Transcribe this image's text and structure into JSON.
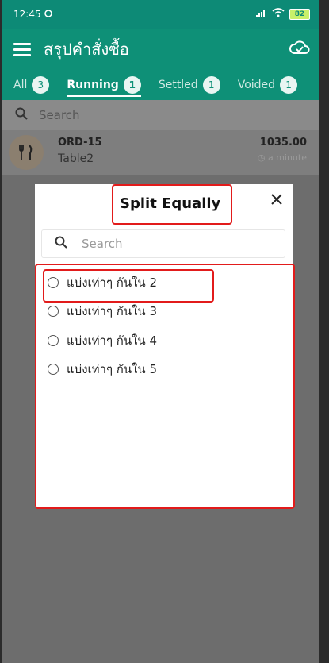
{
  "status": {
    "time": "12:45",
    "battery": "82"
  },
  "appbar": {
    "title": "สรุปคำสั่งซื้อ"
  },
  "tabs": [
    {
      "label": "All",
      "count": "3"
    },
    {
      "label": "Running",
      "count": "1"
    },
    {
      "label": "Settled",
      "count": "1"
    },
    {
      "label": "Voided",
      "count": "1"
    }
  ],
  "search": {
    "placeholder": "Search"
  },
  "order": {
    "id": "ORD-15",
    "table": "Table2",
    "amount": "1035.00",
    "time": "a minute"
  },
  "dialog": {
    "title": "Split Equally",
    "search_placeholder": "Search",
    "options": [
      "แบ่งเท่าๆ กันใน 2",
      "แบ่งเท่าๆ กันใน 3",
      "แบ่งเท่าๆ กันใน 4",
      "แบ่งเท่าๆ กันใน 5"
    ]
  },
  "colors": {
    "primary": "#0e9077",
    "highlight": "#e21b1b"
  }
}
